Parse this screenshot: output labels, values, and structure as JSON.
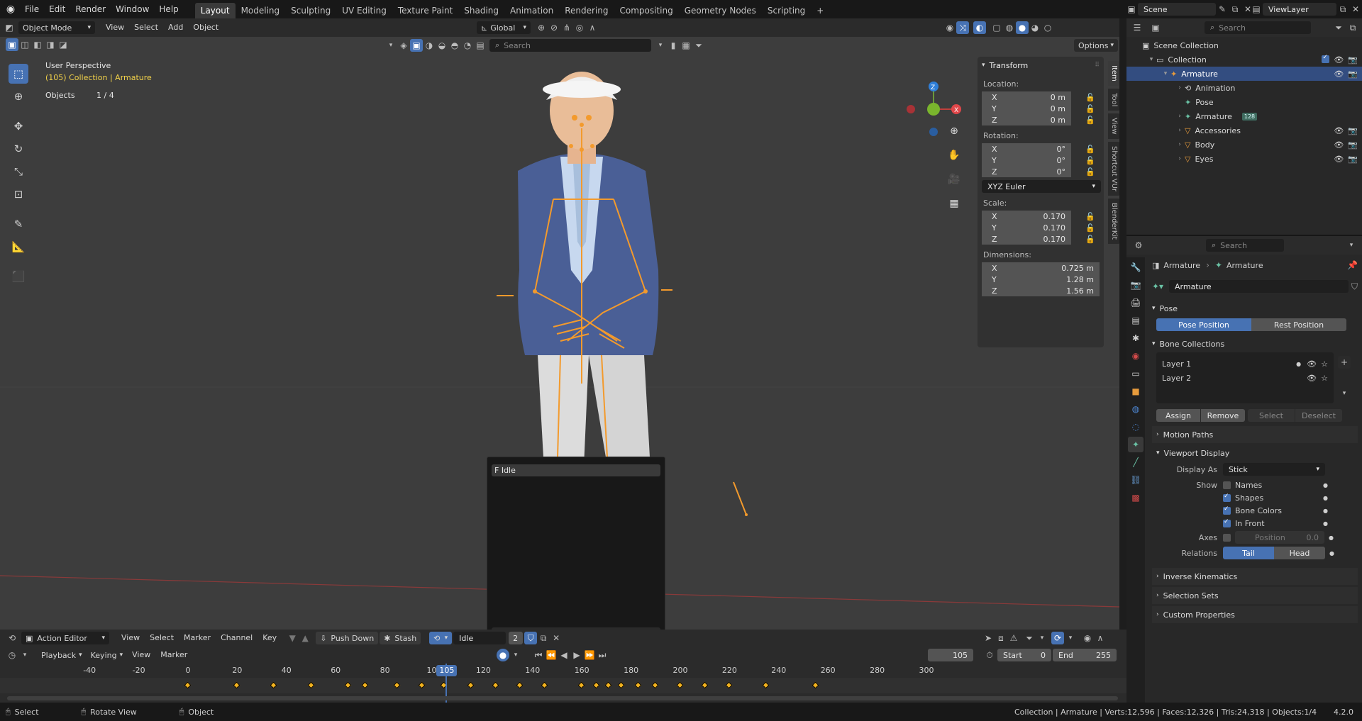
{
  "topbar": {
    "menus": [
      "File",
      "Edit",
      "Render",
      "Window",
      "Help"
    ],
    "workspaces": [
      "Layout",
      "Modeling",
      "Sculpting",
      "UV Editing",
      "Texture Paint",
      "Shading",
      "Animation",
      "Rendering",
      "Compositing",
      "Geometry Nodes",
      "Scripting"
    ],
    "active_workspace": "Layout",
    "add_tab": "+",
    "scene": "Scene",
    "view_layer": "ViewLayer"
  },
  "viewport_header": {
    "mode": "Object Mode",
    "menus": [
      "View",
      "Select",
      "Add",
      "Object"
    ],
    "orientation": "Global",
    "options_label": "Options",
    "search_placeholder": "Search"
  },
  "viewport_overlay": {
    "view_name": "User Perspective",
    "collection_line": "(105) Collection | Armature",
    "objects_label": "Objects",
    "objects_value": "1 / 4"
  },
  "gizmo": {
    "x": "X",
    "y": "Y",
    "z": "Z"
  },
  "transform_panel": {
    "title": "Transform",
    "location_label": "Location:",
    "location": [
      {
        "axis": "X",
        "value": "0 m"
      },
      {
        "axis": "Y",
        "value": "0 m"
      },
      {
        "axis": "Z",
        "value": "0 m"
      }
    ],
    "rotation_label": "Rotation:",
    "rotation": [
      {
        "axis": "X",
        "value": "0°"
      },
      {
        "axis": "Y",
        "value": "0°"
      },
      {
        "axis": "Z",
        "value": "0°"
      }
    ],
    "rotation_mode": "XYZ Euler",
    "scale_label": "Scale:",
    "scale": [
      {
        "axis": "X",
        "value": "0.170"
      },
      {
        "axis": "Y",
        "value": "0.170"
      },
      {
        "axis": "Z",
        "value": "0.170"
      }
    ],
    "dimensions_label": "Dimensions:",
    "dimensions": [
      {
        "axis": "X",
        "value": "0.725 m"
      },
      {
        "axis": "Y",
        "value": "1.28 m"
      },
      {
        "axis": "Z",
        "value": "1.56 m"
      }
    ]
  },
  "sidebar_tabs": [
    "Item",
    "Tool",
    "View",
    "Shortcut VUr",
    "BlenderKit"
  ],
  "action_popup": {
    "item": "F Idle",
    "search_value": ""
  },
  "outliner": {
    "search_placeholder": "Search",
    "items": [
      {
        "label": "Scene Collection",
        "indent": 0
      },
      {
        "label": "Collection",
        "indent": 1
      },
      {
        "label": "Armature",
        "indent": 2,
        "selected": true
      },
      {
        "label": "Animation",
        "indent": 3
      },
      {
        "label": "Pose",
        "indent": 3
      },
      {
        "label": "Armature",
        "indent": 3,
        "badge": "128"
      },
      {
        "label": "Accessories",
        "indent": 3
      },
      {
        "label": "Body",
        "indent": 3
      },
      {
        "label": "Eyes",
        "indent": 3
      }
    ]
  },
  "properties": {
    "search_placeholder": "Search",
    "breadcrumb": [
      "Armature",
      "Armature"
    ],
    "data_name": "Armature",
    "pose_section": "Pose",
    "pose_position": "Pose Position",
    "rest_position": "Rest Position",
    "bone_collections_section": "Bone Collections",
    "layers": [
      "Layer 1",
      "Layer 2"
    ],
    "assign": "Assign",
    "remove": "Remove",
    "select": "Select",
    "deselect": "Deselect",
    "motion_paths": "Motion Paths",
    "viewport_display": "Viewport Display",
    "display_as_label": "Display As",
    "display_as_value": "Stick",
    "show_label": "Show",
    "show_options": [
      {
        "label": "Names",
        "checked": false
      },
      {
        "label": "Shapes",
        "checked": true
      },
      {
        "label": "Bone Colors",
        "checked": true
      },
      {
        "label": "In Front",
        "checked": true
      }
    ],
    "axes_label": "Axes",
    "axes_position_label": "Position",
    "axes_position_value": "0.0",
    "relations_label": "Relations",
    "relations_tail": "Tail",
    "relations_head": "Head",
    "inverse_kinematics": "Inverse Kinematics",
    "selection_sets": "Selection Sets",
    "custom_properties": "Custom Properties"
  },
  "action_editor": {
    "editor_type": "Action Editor",
    "menus": [
      "View",
      "Select",
      "Marker",
      "Channel",
      "Key"
    ],
    "push_down": "Push Down",
    "stash": "Stash",
    "action_name": "Idle",
    "users": "2"
  },
  "timeline": {
    "playback": "Playback",
    "keying": "Keying",
    "view": "View",
    "marker": "Marker",
    "current_frame": "105",
    "start_label": "Start",
    "start_value": "0",
    "end_label": "End",
    "end_value": "255",
    "ruler_ticks": [
      -40,
      -20,
      0,
      20,
      40,
      60,
      80,
      100,
      120,
      140,
      160,
      180,
      200,
      220,
      240,
      260,
      280,
      300
    ],
    "keyframes": [
      0,
      20,
      35,
      50,
      65,
      72,
      85,
      95,
      104,
      115,
      125,
      135,
      145,
      160,
      166,
      171,
      176,
      183,
      190,
      200,
      210,
      220,
      235,
      255
    ]
  },
  "statusbar": {
    "left": [
      {
        "icon": "mouse-left-icon",
        "label": "Select"
      },
      {
        "icon": "mouse-middle-icon",
        "label": "Rotate View"
      },
      {
        "icon": "mouse-right-icon",
        "label": "Object"
      }
    ],
    "stats": "Collection | Armature | Verts:12,596 | Faces:12,326 | Tris:24,318 | Objects:1/4",
    "version": "4.2.0"
  }
}
